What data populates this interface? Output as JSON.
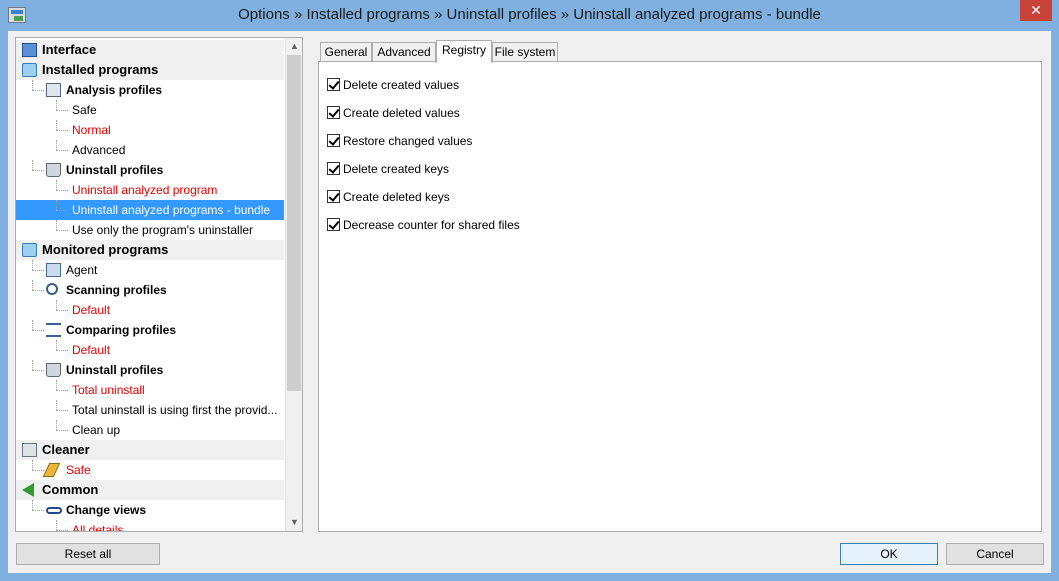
{
  "window": {
    "title": "Options » Installed programs » Uninstall profiles » Uninstall analyzed programs - bundle",
    "close_glyph": "✕"
  },
  "tree": {
    "items": [
      {
        "label": "Interface",
        "kind": "group",
        "icon": "interface-icon"
      },
      {
        "label": "Installed programs",
        "kind": "group",
        "icon": "installed-programs-icon"
      },
      {
        "label": "Analysis profiles",
        "kind": "sub",
        "icon": "analysis-profiles-icon"
      },
      {
        "label": "Safe",
        "kind": "leaf"
      },
      {
        "label": "Normal",
        "kind": "leaf",
        "red": true
      },
      {
        "label": "Advanced",
        "kind": "leaf"
      },
      {
        "label": "Uninstall profiles",
        "kind": "sub",
        "icon": "uninstall-profiles-icon"
      },
      {
        "label": "Uninstall analyzed program",
        "kind": "leaf",
        "red": true
      },
      {
        "label": "Uninstall analyzed programs - bundle",
        "kind": "leaf",
        "selected": true
      },
      {
        "label": "Use only the program's uninstaller",
        "kind": "leaf"
      },
      {
        "label": "Monitored programs",
        "kind": "group",
        "icon": "monitored-programs-icon"
      },
      {
        "label": "Agent",
        "kind": "sub-plain",
        "icon": "agent-icon"
      },
      {
        "label": "Scanning profiles",
        "kind": "sub",
        "icon": "scanning-profiles-icon"
      },
      {
        "label": "Default",
        "kind": "leaf",
        "red": true
      },
      {
        "label": "Comparing profiles",
        "kind": "sub",
        "icon": "comparing-profiles-icon"
      },
      {
        "label": "Default",
        "kind": "leaf",
        "red": true
      },
      {
        "label": "Uninstall profiles",
        "kind": "sub",
        "icon": "uninstall-profiles-icon"
      },
      {
        "label": "Total uninstall",
        "kind": "leaf",
        "red": true
      },
      {
        "label": "Total uninstall is using first the provid...",
        "kind": "leaf"
      },
      {
        "label": "Clean up",
        "kind": "leaf"
      },
      {
        "label": "Cleaner",
        "kind": "group",
        "icon": "cleaner-icon"
      },
      {
        "label": "Safe",
        "kind": "sub-plain",
        "red": true,
        "icon": "broom-icon"
      },
      {
        "label": "Common",
        "kind": "group",
        "icon": "common-icon"
      },
      {
        "label": "Change views",
        "kind": "sub",
        "icon": "glasses-icon"
      },
      {
        "label": "All details",
        "kind": "leaf",
        "red": true
      }
    ],
    "scroll_up_glyph": "▲",
    "scroll_down_glyph": "▼"
  },
  "tabs": [
    {
      "label": "General",
      "active": false
    },
    {
      "label": "Advanced",
      "active": false
    },
    {
      "label": "Registry",
      "active": true
    },
    {
      "label": "File system",
      "active": false
    }
  ],
  "registry_options": [
    {
      "label": "Delete created values",
      "checked": true
    },
    {
      "label": "Create deleted values",
      "checked": true
    },
    {
      "label": "Restore changed values",
      "checked": true
    },
    {
      "label": "Delete created keys",
      "checked": true
    },
    {
      "label": "Create deleted keys",
      "checked": true
    },
    {
      "label": "Decrease counter for shared files",
      "checked": true
    }
  ],
  "buttons": {
    "reset_all": "Reset all",
    "ok": "OK",
    "cancel": "Cancel"
  },
  "colors": {
    "selection": "#3399ff",
    "highlight_text": "#e00000",
    "frame": "#7fb0e0"
  }
}
